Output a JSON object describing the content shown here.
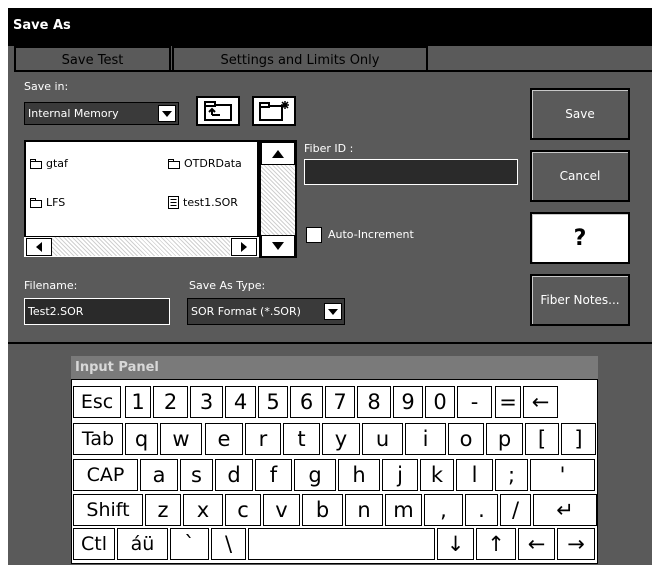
{
  "window": {
    "title": "Save As"
  },
  "tabs": [
    {
      "label": "Save Test"
    },
    {
      "label": "Settings and Limits Only"
    }
  ],
  "save_in": {
    "label": "Save in:",
    "value": "Internal Memory"
  },
  "files": [
    {
      "name": "gtaf",
      "icon": "folder-icon"
    },
    {
      "name": "OTDRData",
      "icon": "folder-icon"
    },
    {
      "name": "LFS",
      "icon": "folder-icon"
    },
    {
      "name": "test1.SOR",
      "icon": "file-icon"
    }
  ],
  "fiber_id": {
    "label": "Fiber ID :",
    "value": ""
  },
  "auto_increment": {
    "label": "Auto-Increment",
    "checked": false
  },
  "filename": {
    "label": "Filename:",
    "value": "Test2.SOR"
  },
  "save_as_type": {
    "label": "Save As Type:",
    "value": "SOR Format (*.SOR)"
  },
  "buttons": {
    "save": "Save",
    "cancel": "Cancel",
    "help": "?",
    "fiber_notes": "Fiber Notes..."
  },
  "input_panel": {
    "title": "Input Panel",
    "rows": [
      [
        "Esc",
        "1",
        "2",
        "3",
        "4",
        "5",
        "6",
        "7",
        "8",
        "9",
        "0",
        "-",
        "=",
        "←"
      ],
      [
        "Tab",
        "q",
        "w",
        "e",
        "r",
        "t",
        "y",
        "u",
        "i",
        "o",
        "p",
        "[",
        "]"
      ],
      [
        "CAP",
        "a",
        "s",
        "d",
        "f",
        "g",
        "h",
        "j",
        "k",
        "l",
        ";",
        "'"
      ],
      [
        "Shift",
        "z",
        "x",
        "c",
        "v",
        "b",
        "n",
        "m",
        ",",
        ".",
        "/",
        "↵"
      ],
      [
        "Ctl",
        "áü",
        "`",
        "\\",
        "",
        "↓",
        "↑",
        "←",
        "→"
      ]
    ]
  }
}
